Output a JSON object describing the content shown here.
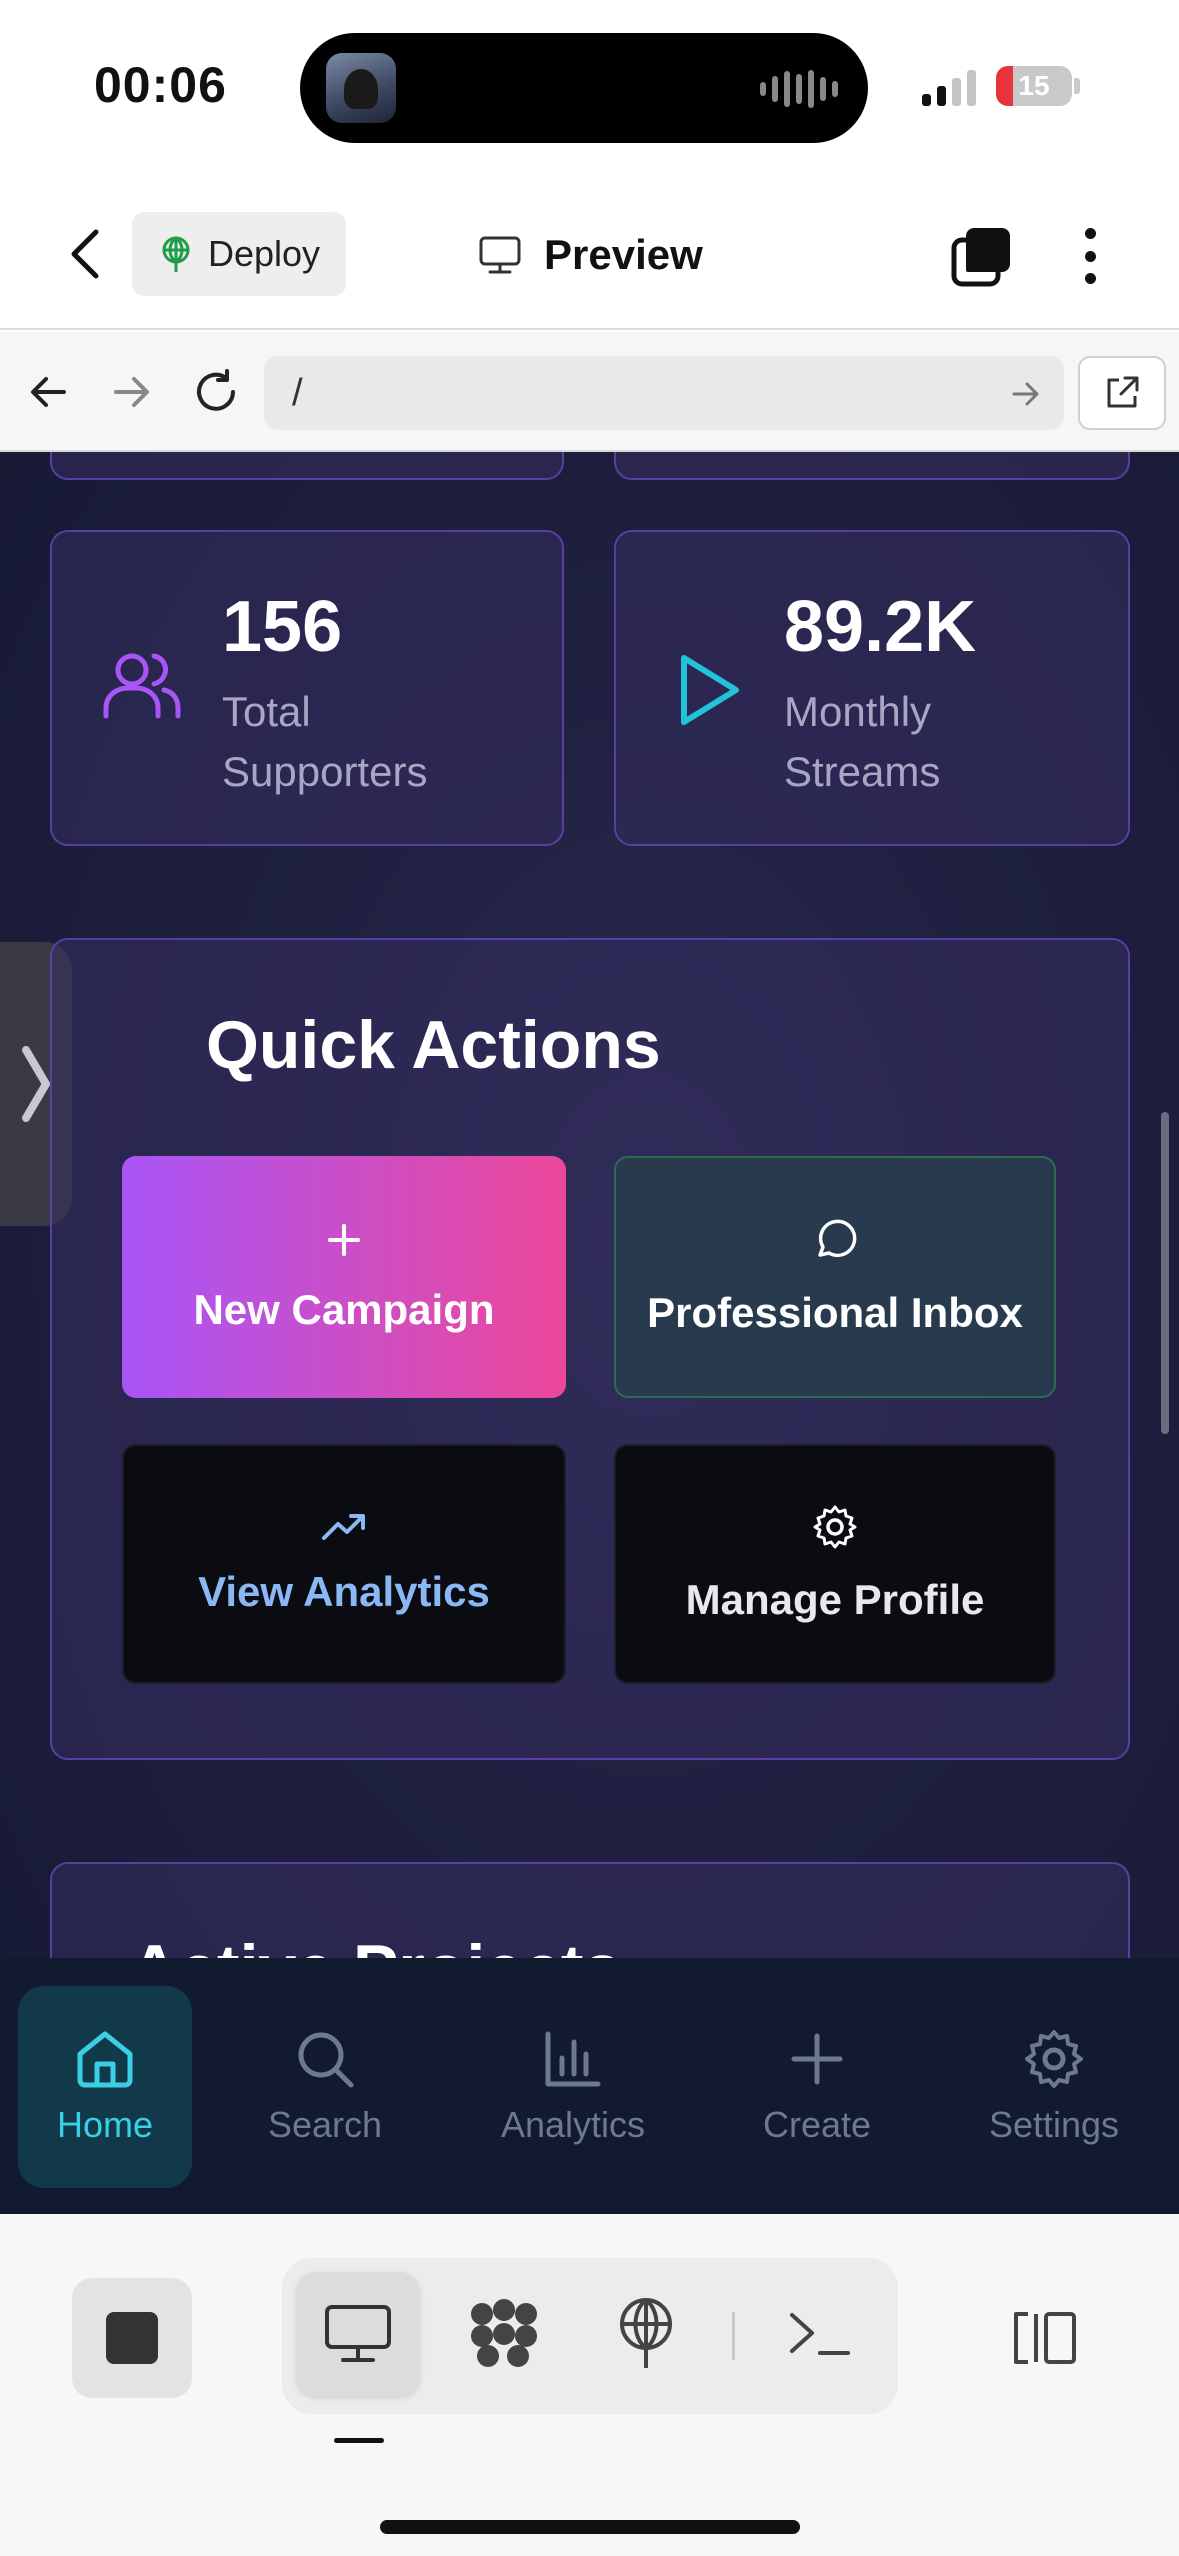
{
  "status": {
    "time": "00:06",
    "battery": "15"
  },
  "header": {
    "deploy_label": "Deploy",
    "preview_label": "Preview"
  },
  "urlbar": {
    "url": "/"
  },
  "stats": [
    {
      "value": "156",
      "label_line1": "Total",
      "label_line2": "Supporters",
      "icon": "users-icon"
    },
    {
      "value": "89.2K",
      "label_line1": "Monthly",
      "label_line2": "Streams",
      "icon": "play-icon"
    }
  ],
  "quick_actions": {
    "title": "Quick Actions",
    "buttons": [
      {
        "label": "New Campaign",
        "icon": "plus-icon"
      },
      {
        "label": "Professional Inbox",
        "icon": "message-circle-icon"
      },
      {
        "label": "View Analytics",
        "icon": "trending-up-icon"
      },
      {
        "label": "Manage Profile",
        "icon": "gear-icon"
      }
    ]
  },
  "next_section": {
    "title": "Active Projects"
  },
  "tabbar": {
    "items": [
      {
        "label": "Home",
        "icon": "home-icon",
        "active": true
      },
      {
        "label": "Search",
        "icon": "search-icon",
        "active": false
      },
      {
        "label": "Analytics",
        "icon": "bar-chart-icon",
        "active": false
      },
      {
        "label": "Create",
        "icon": "plus-icon",
        "active": false
      },
      {
        "label": "Settings",
        "icon": "gear-icon",
        "active": false
      }
    ]
  },
  "colors": {
    "accent_cyan": "#39d0e6",
    "accent_purple": "#a855f7",
    "accent_pink": "#ec4899",
    "card_border": "#5a3fa3",
    "analytics_blue": "#8ab8f5"
  }
}
